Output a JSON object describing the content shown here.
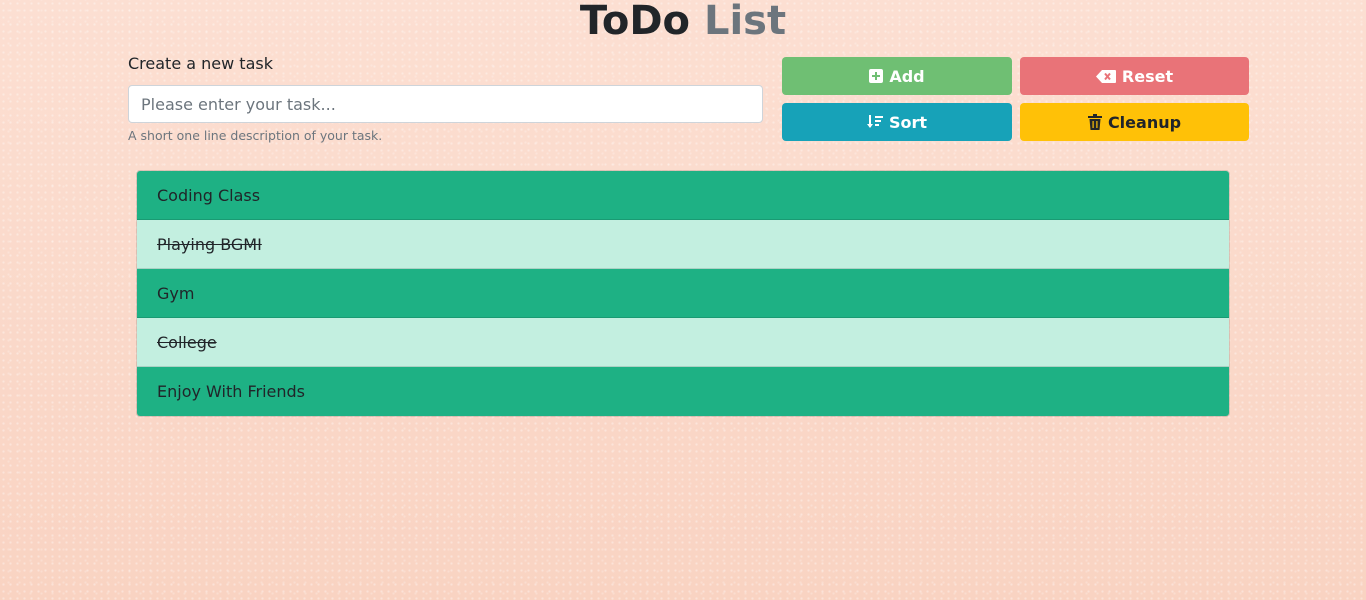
{
  "header": {
    "title_part1": "ToDo",
    "title_part2": "List"
  },
  "form": {
    "label": "Create a new task",
    "placeholder": "Please enter your task...",
    "value": "",
    "help": "A short one line description of your task."
  },
  "buttons": {
    "add": {
      "label": "Add",
      "icon": "plus-square-icon",
      "color": "#6fbf73"
    },
    "reset": {
      "label": "Reset",
      "icon": "backspace-icon",
      "color": "#e97378"
    },
    "sort": {
      "label": "Sort",
      "icon": "sort-amount-down-icon",
      "color": "#17a2b8"
    },
    "cleanup": {
      "label": "Cleanup",
      "icon": "trash-icon",
      "color": "#ffc107"
    }
  },
  "tasks": [
    {
      "text": "Coding Class",
      "done": false
    },
    {
      "text": "Playing BGMI",
      "done": true
    },
    {
      "text": "Gym",
      "done": false
    },
    {
      "text": "College",
      "done": true
    },
    {
      "text": "Enjoy With Friends",
      "done": false
    }
  ],
  "colors": {
    "active_task": "#1eb184",
    "done_task": "#c3efe0"
  }
}
